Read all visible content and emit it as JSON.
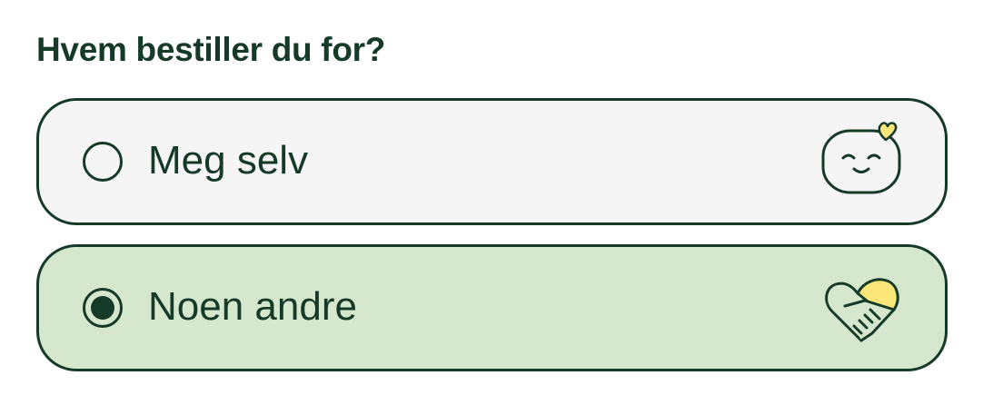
{
  "question": {
    "title": "Hvem bestiller du for?"
  },
  "options": [
    {
      "label": "Meg selv",
      "selected": false,
      "icon": "smiling-face-with-heart-icon"
    },
    {
      "label": "Noen andre",
      "selected": true,
      "icon": "heart-handshake-icon"
    }
  ],
  "colors": {
    "text": "#163a28",
    "unselected_background": "#f5f5f5",
    "selected_background": "#d5e8cd",
    "accent_yellow": "#fbe67a"
  }
}
